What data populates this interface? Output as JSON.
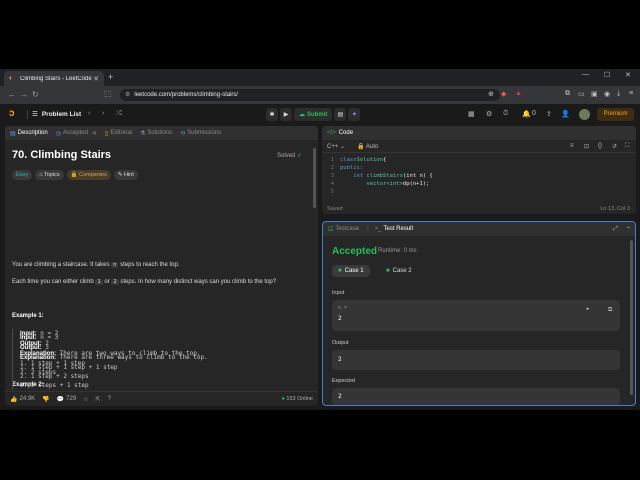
{
  "browser": {
    "tab_title": "Climbing Stairs - LeetCode",
    "url": "leetcode.com/problems/climbing-stairs/"
  },
  "header": {
    "problem_list": "Problem List",
    "submit": "Submit",
    "notif_count": "0",
    "premium": "Premium"
  },
  "description": {
    "tabs": [
      "Description",
      "Accepted",
      "Editorial",
      "Solutions",
      "Submissions"
    ],
    "title": "70. Climbing Stairs",
    "status": "Solved",
    "tags": [
      "Easy",
      "Topics",
      "Companies",
      "Hint"
    ],
    "para1_a": "You are climbing a staircase. It takes",
    "para1_code": "n",
    "para1_b": "steps to reach the top.",
    "para2_a": "Each time you can either climb",
    "para2_code1": "1",
    "para2_or": "or",
    "para2_code2": "2",
    "para2_b": "steps. In how many distinct ways can you climb to the top?",
    "ex1_h": "Example 1:",
    "ex1": {
      "input_l": "Input:",
      "input_v": "n = 2",
      "output_l": "Output:",
      "output_v": "2",
      "expl_l": "Explanation:",
      "expl_v": "There are two ways to climb to the top.",
      "l1": "1. 1 step + 1 step",
      "l2": "2. 2 steps"
    },
    "ex2_h": "Example 2:",
    "ex2": {
      "input_l": "Input:",
      "input_v": "n = 3",
      "output_l": "Output:",
      "output_v": "3",
      "expl_l": "Explanation:",
      "expl_v": "There are three ways to climb to the top.",
      "l1": "1. 1 step + 1 step + 1 step",
      "l2": "2. 1 step + 2 steps",
      "l3": "3. 2 steps + 1 step"
    },
    "footer": {
      "likes": "24.9K",
      "comments": "729",
      "online": "153 Online"
    }
  },
  "code": {
    "title": "Code",
    "lang": "C++",
    "mode": "Auto",
    "lines": [
      {
        "n": "1",
        "t1": "class ",
        "t2": "Solution",
        "t3": " {"
      },
      {
        "n": "2",
        "t1": "public:",
        "t2": "",
        "t3": ""
      },
      {
        "n": "3",
        "t1": "    int ",
        "t2": "climbStairs",
        "t3": "(int n) {"
      },
      {
        "n": "4",
        "t1": "        vector<int>",
        "t2": "dp",
        "t3": "(n+1);"
      },
      {
        "n": "5",
        "t1": "",
        "t2": "",
        "t3": ""
      }
    ],
    "saved": "Saved",
    "cursor": "Ln 13, Col 3"
  },
  "test": {
    "tab_testcase": "Testcase",
    "tab_result": "Test Result",
    "status": "Accepted",
    "runtime": "Runtime: 0 ms",
    "case1": "Case 1",
    "case2": "Case 2",
    "input_label": "Input",
    "input_var": "n =",
    "input_val": "2",
    "output_label": "Output",
    "output_val": "2",
    "expected_label": "Expected",
    "expected_val": "2"
  },
  "colors": {
    "accent_green": "#2cbb5d",
    "brand_orange": "#ffa116",
    "focus_blue": "#3f7fd6"
  }
}
